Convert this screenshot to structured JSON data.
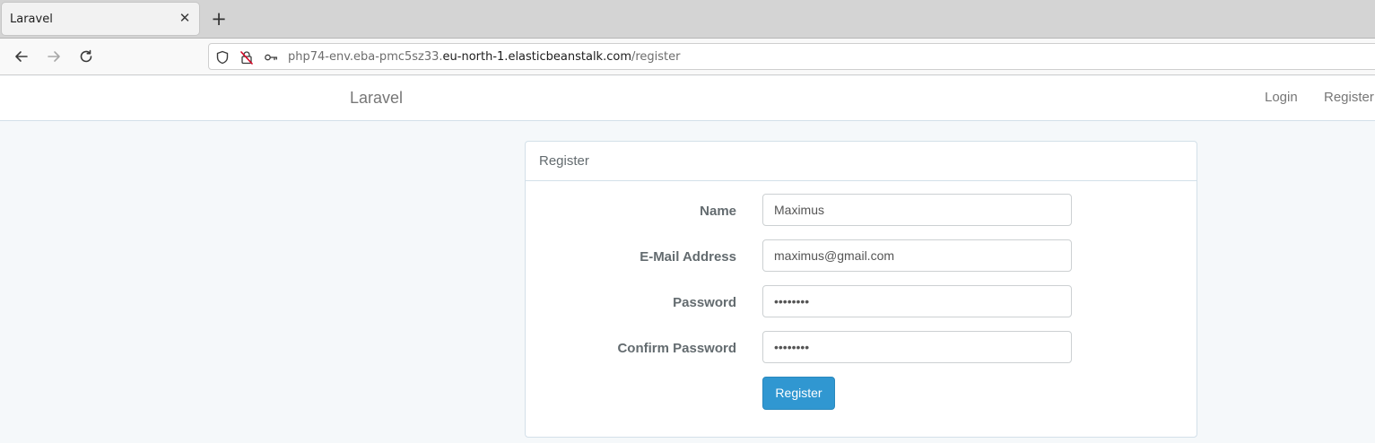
{
  "browser": {
    "tab_title": "Laravel",
    "tab_close": "✕",
    "new_tab": "+",
    "url_prefix": "php74-env.eba-pmc5sz33.",
    "url_host": "eu-north-1.elasticbeanstalk.com",
    "url_path": "/register"
  },
  "appnav": {
    "brand": "Laravel",
    "login": "Login",
    "register": "Register"
  },
  "card": {
    "title": "Register",
    "fields": [
      {
        "label": "Name",
        "value": "Maximus"
      },
      {
        "label": "E-Mail Address",
        "value": "maximus@gmail.com"
      },
      {
        "label": "Password",
        "value": "••••••••"
      },
      {
        "label": "Confirm Password",
        "value": "••••••••"
      }
    ],
    "submit": "Register"
  },
  "colors": {
    "primary": "#3097d1",
    "background": "#f5f8fa",
    "text": "#636b6f"
  }
}
